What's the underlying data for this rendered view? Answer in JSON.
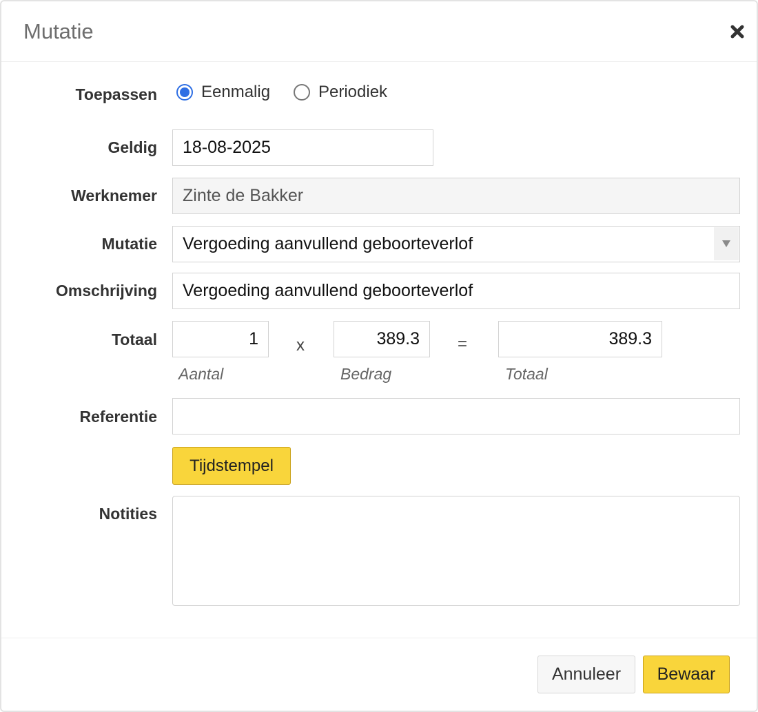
{
  "dialog": {
    "title": "Mutatie"
  },
  "form": {
    "toepassen": {
      "label": "Toepassen",
      "options": [
        "Eenmalig",
        "Periodiek"
      ],
      "selected": "Eenmalig"
    },
    "geldig": {
      "label": "Geldig",
      "value": "18-08-2025"
    },
    "werknemer": {
      "label": "Werknemer",
      "value": "Zinte de Bakker"
    },
    "mutatie": {
      "label": "Mutatie",
      "selected": "Vergoeding aanvullend geboorteverlof"
    },
    "omschrijving": {
      "label": "Omschrijving",
      "value": "Vergoeding aanvullend geboorteverlof"
    },
    "totaal": {
      "label": "Totaal",
      "aantal": "1",
      "bedrag": "389.3",
      "totaal": "389.3",
      "multiply_sign": "x",
      "equals_sign": "=",
      "aantal_hint": "Aantal",
      "bedrag_hint": "Bedrag",
      "totaal_hint": "Totaal"
    },
    "referentie": {
      "label": "Referentie",
      "value": ""
    },
    "tijdstempel_button": "Tijdstempel",
    "notities": {
      "label": "Notities",
      "value": ""
    }
  },
  "footer": {
    "cancel_label": "Annuleer",
    "save_label": "Bewaar"
  },
  "colors": {
    "accent_yellow": "#f9d53b",
    "radio_blue": "#2f6fe4"
  },
  "icons": {
    "close": "close-icon",
    "select_arrow": "chevron-down-icon"
  }
}
